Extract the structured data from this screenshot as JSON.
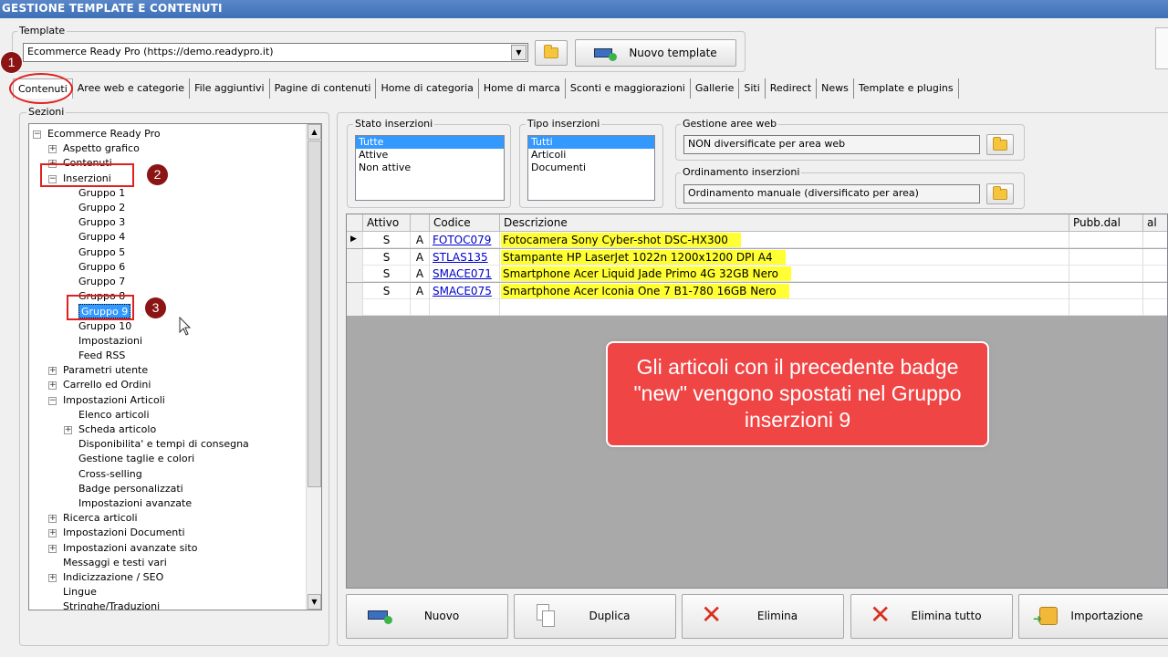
{
  "window": {
    "title": "GESTIONE TEMPLATE E CONTENUTI"
  },
  "template": {
    "group_label": "Template",
    "combo_value": "Ecommerce Ready Pro (https://demo.readypro.it)",
    "new_button": "Nuovo template"
  },
  "tabs": [
    "Contenuti",
    "Aree web e categorie",
    "File aggiuntivi",
    "Pagine di contenuti",
    "Home di categoria",
    "Home di marca",
    "Sconti e maggiorazioni",
    "Gallerie",
    "Siti",
    "Redirect",
    "News",
    "Template e plugins"
  ],
  "sections": {
    "group_label": "Sezioni",
    "tree": [
      {
        "label": "Ecommerce Ready Pro",
        "level": 0,
        "exp": "minus"
      },
      {
        "label": "Aspetto grafico",
        "level": 1,
        "exp": "plus"
      },
      {
        "label": "Contenuti",
        "level": 1,
        "exp": "plus"
      },
      {
        "label": "Inserzioni",
        "level": 1,
        "exp": "minus"
      },
      {
        "label": "Gruppo 1",
        "level": 2,
        "exp": ""
      },
      {
        "label": "Gruppo 2",
        "level": 2,
        "exp": ""
      },
      {
        "label": "Gruppo 3",
        "level": 2,
        "exp": ""
      },
      {
        "label": "Gruppo 4",
        "level": 2,
        "exp": ""
      },
      {
        "label": "Gruppo 5",
        "level": 2,
        "exp": ""
      },
      {
        "label": "Gruppo 6",
        "level": 2,
        "exp": ""
      },
      {
        "label": "Gruppo 7",
        "level": 2,
        "exp": ""
      },
      {
        "label": "Gruppo 8",
        "level": 2,
        "exp": ""
      },
      {
        "label": "Gruppo 9",
        "level": 2,
        "exp": "",
        "selected": true
      },
      {
        "label": "Gruppo 10",
        "level": 2,
        "exp": ""
      },
      {
        "label": "Impostazioni",
        "level": 2,
        "exp": ""
      },
      {
        "label": "Feed RSS",
        "level": 2,
        "exp": ""
      },
      {
        "label": "Parametri utente",
        "level": 1,
        "exp": "plus"
      },
      {
        "label": "Carrello ed Ordini",
        "level": 1,
        "exp": "plus"
      },
      {
        "label": "Impostazioni Articoli",
        "level": 1,
        "exp": "minus"
      },
      {
        "label": "Elenco articoli",
        "level": 2,
        "exp": ""
      },
      {
        "label": "Scheda articolo",
        "level": 2,
        "exp": "plus"
      },
      {
        "label": "Disponibilita' e tempi di consegna",
        "level": 2,
        "exp": ""
      },
      {
        "label": "Gestione taglie e colori",
        "level": 2,
        "exp": ""
      },
      {
        "label": "Cross-selling",
        "level": 2,
        "exp": ""
      },
      {
        "label": "Badge personalizzati",
        "level": 2,
        "exp": ""
      },
      {
        "label": "Impostazioni avanzate",
        "level": 2,
        "exp": ""
      },
      {
        "label": "Ricerca articoli",
        "level": 1,
        "exp": "plus"
      },
      {
        "label": "Impostazioni Documenti",
        "level": 1,
        "exp": "plus"
      },
      {
        "label": "Impostazioni avanzate sito",
        "level": 1,
        "exp": "plus"
      },
      {
        "label": "Messaggi e testi vari",
        "level": 1,
        "exp": ""
      },
      {
        "label": "Indicizzazione / SEO",
        "level": 1,
        "exp": "plus"
      },
      {
        "label": "Lingue",
        "level": 1,
        "exp": ""
      },
      {
        "label": "Stringhe/Traduzioni",
        "level": 1,
        "exp": ""
      }
    ]
  },
  "filters": {
    "stato": {
      "label": "Stato inserzioni",
      "options": [
        "Tutte",
        "Attive",
        "Non attive"
      ]
    },
    "tipo": {
      "label": "Tipo inserzioni",
      "options": [
        "Tutti",
        "Articoli",
        "Documenti"
      ]
    },
    "aree": {
      "label": "Gestione aree web",
      "value": "NON diversificate per area web"
    },
    "ordinamento": {
      "label": "Ordinamento inserzioni",
      "value": "Ordinamento manuale (diversificato per area)"
    }
  },
  "grid": {
    "columns": [
      "Attivo",
      "Codice",
      "Descrizione",
      "Pubb.dal",
      "al"
    ],
    "rows": [
      {
        "attivo": "S",
        "tipo": "A",
        "codice": "FOTOC079",
        "descrizione": "Fotocamera Sony Cyber-shot DSC-HX300"
      },
      {
        "attivo": "S",
        "tipo": "A",
        "codice": "STLAS135",
        "descrizione": "Stampante HP LaserJet 1022n 1200x1200 DPI A4"
      },
      {
        "attivo": "S",
        "tipo": "A",
        "codice": "SMACE071",
        "descrizione": "Smartphone Acer Liquid Jade Primo 4G 32GB Nero"
      },
      {
        "attivo": "S",
        "tipo": "A",
        "codice": "SMACE075",
        "descrizione": "Smartphone Acer Iconia One 7 B1-780 16GB Nero"
      }
    ]
  },
  "callout": {
    "text": "Gli articoli con il precedente badge \"new\" vengono spostati nel Gruppo inserzioni 9"
  },
  "badges": [
    "1",
    "2",
    "3"
  ],
  "actions": [
    "Nuovo",
    "Duplica",
    "Elimina",
    "Elimina tutto",
    "Importazione"
  ],
  "colors": {
    "highlight": "#ffff33",
    "callout": "#f04545",
    "badge": "#8b1414",
    "selection": "#3399ff"
  }
}
